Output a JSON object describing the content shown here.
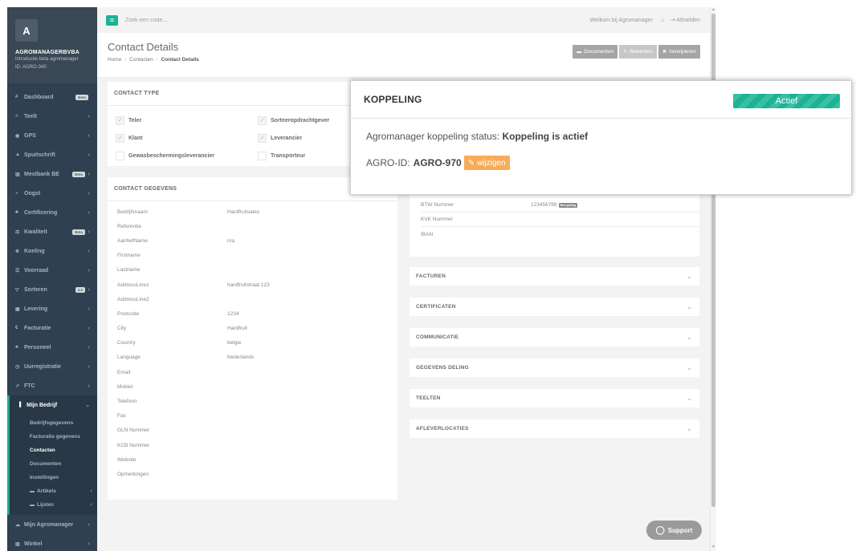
{
  "sidebar": {
    "logo_letter": "A",
    "company_name": "AGROMANAGERBVBA",
    "company_sub": "Introductie beta agromanager",
    "company_id": "ID: AGRO-340",
    "items": [
      {
        "label": "Dashboard",
        "icon": "#",
        "badge": "Beta",
        "chev": ""
      },
      {
        "label": "Teelt",
        "icon": "≡",
        "badge": "",
        "chev": "‹"
      },
      {
        "label": "GPS",
        "icon": "◉",
        "badge": "",
        "chev": "‹"
      },
      {
        "label": "Spuitschrift",
        "icon": "▲",
        "badge": "",
        "chev": "‹"
      },
      {
        "label": "Mestbank BE",
        "icon": "▥",
        "badge": "Beta",
        "chev": "‹"
      },
      {
        "label": "Oogst",
        "icon": "◒",
        "badge": "",
        "chev": "‹"
      },
      {
        "label": "Certificering",
        "icon": "■",
        "badge": "",
        "chev": "‹"
      },
      {
        "label": "Kwaliteit",
        "icon": "⚖",
        "badge": "Beta",
        "chev": "‹"
      },
      {
        "label": "Koeling",
        "icon": "❄",
        "badge": "",
        "chev": "‹"
      },
      {
        "label": "Voorraad",
        "icon": "☰",
        "badge": "",
        "chev": "‹"
      },
      {
        "label": "Sorteren",
        "icon": "▽",
        "badge": "2.0",
        "chev": "‹"
      },
      {
        "label": "Levering",
        "icon": "▣",
        "badge": "",
        "chev": "‹"
      },
      {
        "label": "Facturatie",
        "icon": "€",
        "badge": "",
        "chev": "‹"
      },
      {
        "label": "Personeel",
        "icon": "♣",
        "badge": "",
        "chev": "‹"
      },
      {
        "label": "Uurregistratie",
        "icon": "◷",
        "badge": "",
        "chev": "‹"
      },
      {
        "label": "FTC",
        "icon": "↗",
        "badge": "",
        "chev": "‹"
      }
    ],
    "active_item": {
      "label": "Mijn Bedrijf",
      "icon": "▐",
      "chev": "⌄"
    },
    "sub_items": [
      {
        "label": "Bedrijfsgegevens",
        "active": false,
        "icon": "",
        "chev": ""
      },
      {
        "label": "Facturatie gegevens",
        "active": false,
        "icon": "",
        "chev": ""
      },
      {
        "label": "Contacten",
        "active": true,
        "icon": "",
        "chev": ""
      },
      {
        "label": "Documenten",
        "active": false,
        "icon": "",
        "chev": ""
      },
      {
        "label": "Instellingen",
        "active": false,
        "icon": "",
        "chev": ""
      },
      {
        "label": "Artikels",
        "active": false,
        "icon": "▬",
        "chev": "‹"
      },
      {
        "label": "Lijsten",
        "active": false,
        "icon": "▬",
        "chev": "‹"
      }
    ],
    "after_items": [
      {
        "label": "Mijn Agromanager",
        "icon": "☁",
        "chev": "‹"
      },
      {
        "label": "Winkel",
        "icon": "▤",
        "chev": "‹"
      }
    ]
  },
  "topbar": {
    "menu_icon": "≡",
    "search_placeholder": "Zoek een code...",
    "welcome": "Welkom bij Agromanager",
    "home_icon": "⌂",
    "logout_icon": "⇥",
    "logout": "Afmelden"
  },
  "heading": {
    "title": "Contact Details",
    "breadcrumb": [
      "Home",
      "Contacten",
      "Contact Details"
    ],
    "buttons": [
      {
        "label": "Documenten",
        "icon": "▬",
        "disabled": false
      },
      {
        "label": "Bewerken",
        "icon": "✎",
        "disabled": true
      },
      {
        "label": "Verwijderen",
        "icon": "✖",
        "disabled": false
      }
    ]
  },
  "contact_type": {
    "title": "CONTACT TYPE",
    "rows": [
      [
        {
          "label": "Teler",
          "checked": true
        },
        {
          "label": "Sorteeropdrachtgever",
          "checked": true
        }
      ],
      [
        {
          "label": "Klant",
          "checked": true
        },
        {
          "label": "Leverancier",
          "checked": true
        }
      ],
      [
        {
          "label": "Gewasbeschermingsleverancier",
          "checked": false
        },
        {
          "label": "Transporteur",
          "checked": false
        }
      ]
    ]
  },
  "contact_gegevens": {
    "title": "CONTACT GEGEVENS",
    "rows": [
      {
        "label": "Bedrijfsnaam",
        "value": "Hardfruitsales"
      },
      {
        "label": "Referentie",
        "value": ""
      },
      {
        "label": "AanhefName",
        "value": "n/a"
      },
      {
        "label": "Firstname",
        "value": ""
      },
      {
        "label": "Lastname",
        "value": ""
      },
      {
        "label": "AddressLine1",
        "value": "hardfruitstraat 123"
      },
      {
        "label": "AddressLine2",
        "value": ""
      },
      {
        "label": "Postcode",
        "value": "1234"
      },
      {
        "label": "City",
        "value": "Hardfruit"
      },
      {
        "label": "Country",
        "value": "belgie"
      },
      {
        "label": "Language",
        "value": "Nederlands"
      },
      {
        "label": "Email",
        "value": ""
      },
      {
        "label": "Mobiel",
        "value": ""
      },
      {
        "label": "Telefoon",
        "value": ""
      },
      {
        "label": "Fax",
        "value": ""
      },
      {
        "label": "GLN Nummer",
        "value": ""
      },
      {
        "label": "KCB Nummer",
        "value": ""
      },
      {
        "label": "Website",
        "value": ""
      },
      {
        "label": "Opmerkingen",
        "value": ""
      }
    ]
  },
  "financial": {
    "rows": [
      {
        "label": "BTW Nummer",
        "value": "123456789",
        "badge": "Niet geldig"
      },
      {
        "label": "KVK Nummer",
        "value": "",
        "badge": ""
      },
      {
        "label": "IBAN",
        "value": "",
        "badge": ""
      }
    ]
  },
  "sections": [
    "FACTUREN",
    "CERTIFICATEN",
    "COMMUNICATIE",
    "GEGEVENS DELING",
    "TEELTEN",
    "AFLEVERLOCATIES"
  ],
  "section_chev": "⌄",
  "support": {
    "label": "Support",
    "icon": "◯"
  },
  "modal": {
    "title": "KOPPELING",
    "status_badge": "Actief",
    "status_text": "Agromanager koppeling status:",
    "status_value": "Koppeling is actief",
    "id_label": "AGRO-ID:",
    "id_value": "AGRO-970",
    "edit_icon": "✎",
    "edit_label": "wijzigen"
  },
  "colors": {
    "accent": "#1ab394",
    "warning": "#f8ac59",
    "sidebar": "#2f4050"
  }
}
